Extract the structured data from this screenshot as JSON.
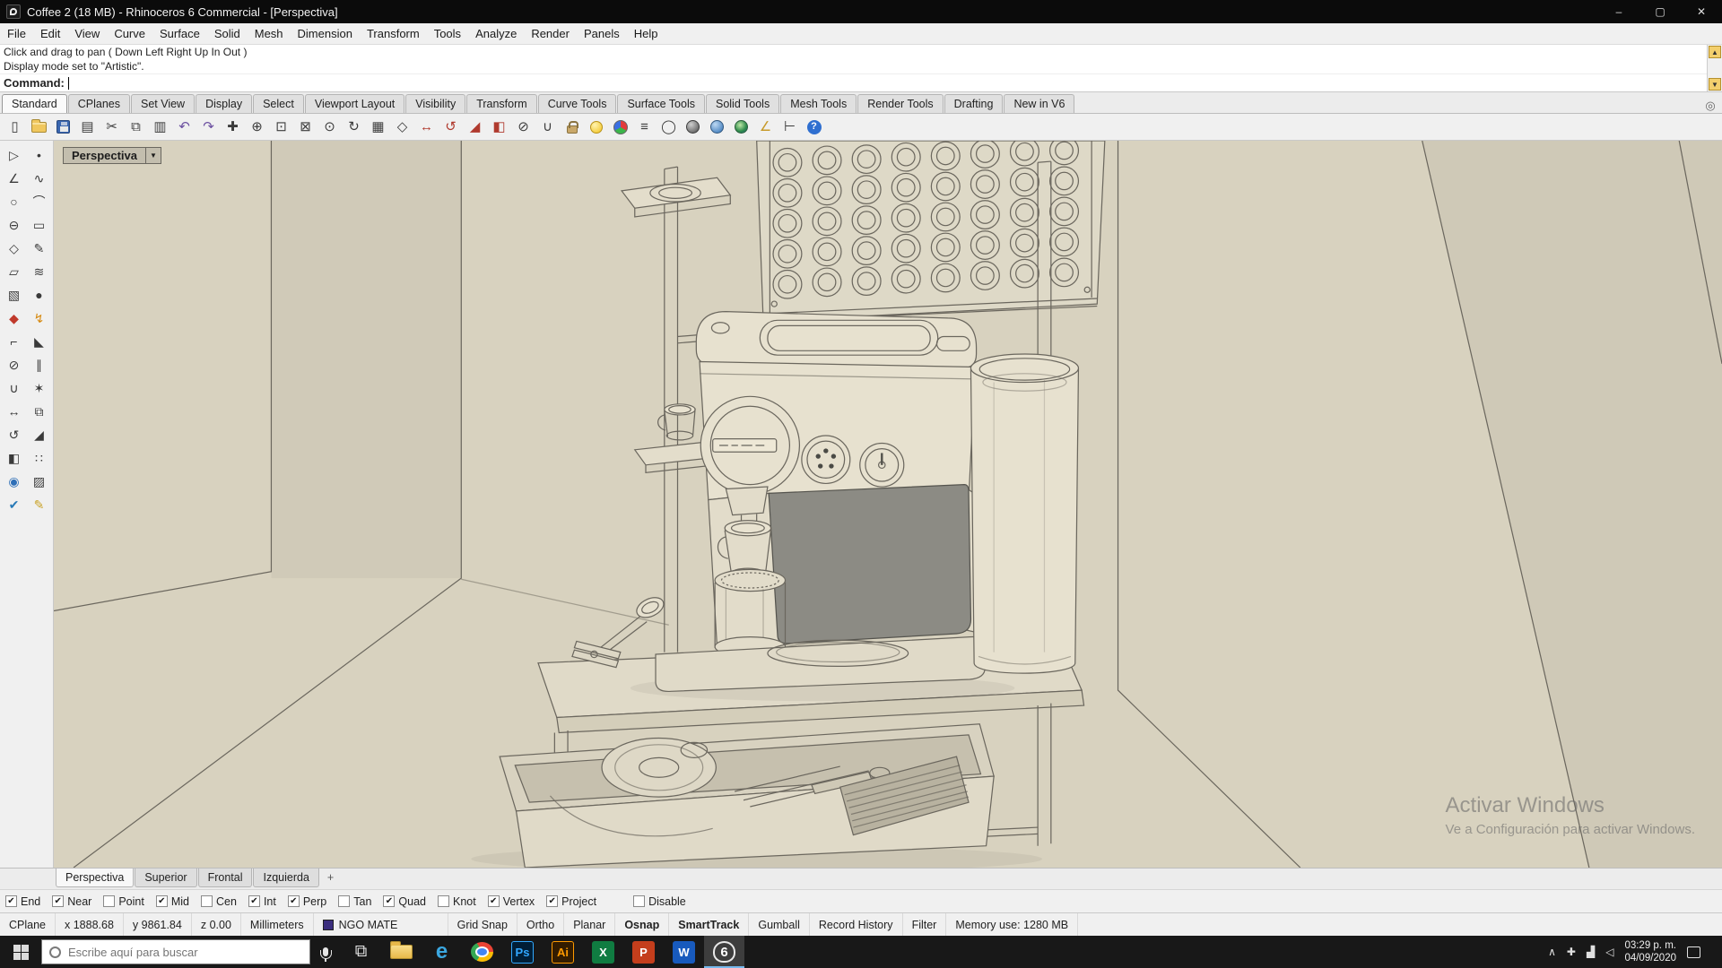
{
  "window": {
    "title": "Coffee 2 (18 MB) - Rhinoceros 6 Commercial - [Perspectiva]",
    "minimize": "–",
    "maximize": "▢",
    "close": "✕"
  },
  "menu": {
    "items": [
      "File",
      "Edit",
      "View",
      "Curve",
      "Surface",
      "Solid",
      "Mesh",
      "Dimension",
      "Transform",
      "Tools",
      "Analyze",
      "Render",
      "Panels",
      "Help"
    ]
  },
  "command": {
    "history": [
      "Click and drag to pan ( Down  Left  Right  Up  In  Out )",
      "Display mode set to \"Artistic\"."
    ],
    "prompt": "Command:",
    "scroll_up": "▲",
    "scroll_down": "▼"
  },
  "toolbar": {
    "options_glyph": "◎",
    "tabs": [
      {
        "label": "Standard",
        "cls": "active"
      },
      {
        "label": "CPlanes"
      },
      {
        "label": "Set View"
      },
      {
        "label": "Display"
      },
      {
        "label": "Select"
      },
      {
        "label": "Viewport Layout"
      },
      {
        "label": "Visibility"
      },
      {
        "label": "Transform"
      },
      {
        "label": "Curve Tools"
      },
      {
        "label": "Surface Tools"
      },
      {
        "label": "Solid Tools"
      },
      {
        "label": "Mesh Tools"
      },
      {
        "label": "Render Tools"
      },
      {
        "label": "Drafting"
      },
      {
        "label": "New in V6"
      }
    ],
    "icons": [
      {
        "name": "new-file-icon",
        "glyph": "▯"
      },
      {
        "name": "open-file-icon",
        "cls": "icon-folder"
      },
      {
        "name": "save-file-icon",
        "cls": "icon-save"
      },
      {
        "name": "print-icon",
        "glyph": "▤"
      },
      {
        "name": "cut-icon",
        "glyph": "✂"
      },
      {
        "name": "copy-icon",
        "glyph": "⧉"
      },
      {
        "name": "paste-icon",
        "glyph": "▥"
      },
      {
        "name": "undo-icon",
        "glyph": "↶",
        "color": "#6b4fa0"
      },
      {
        "name": "redo-icon",
        "glyph": "↷",
        "color": "#6b4fa0"
      },
      {
        "name": "pan-icon",
        "glyph": "✚"
      },
      {
        "name": "zoom-dynamic-icon",
        "glyph": "⊕"
      },
      {
        "name": "zoom-window-icon",
        "glyph": "⊡"
      },
      {
        "name": "zoom-extents-icon",
        "glyph": "⊠"
      },
      {
        "name": "zoom-selected-icon",
        "glyph": "⊙"
      },
      {
        "name": "rotate-view-icon",
        "glyph": "↻"
      },
      {
        "name": "viewport-layout-icon",
        "glyph": "▦"
      },
      {
        "name": "set-view-icon",
        "glyph": "◇"
      },
      {
        "name": "move-icon",
        "glyph": "↔",
        "color": "#b03a2e"
      },
      {
        "name": "rotate-icon",
        "glyph": "↺",
        "color": "#b03a2e"
      },
      {
        "name": "scale-icon",
        "glyph": "◢",
        "color": "#b03a2e"
      },
      {
        "name": "mirror-icon",
        "glyph": "◧",
        "color": "#b03a2e"
      },
      {
        "name": "trim-icon",
        "glyph": "⊘"
      },
      {
        "name": "join-icon",
        "glyph": "∪"
      },
      {
        "name": "lock-icon",
        "cls": "icon-lock"
      },
      {
        "name": "hide-lightbulb-icon",
        "cls": "icon-bulb"
      },
      {
        "name": "layers-icon",
        "cls": "icon-wheel"
      },
      {
        "name": "properties-icon",
        "glyph": "≡"
      },
      {
        "name": "wireframe-display-icon",
        "glyph": "◯"
      },
      {
        "name": "shaded-display-icon",
        "cls": "icon-sphere-dark"
      },
      {
        "name": "rendered-display-icon",
        "cls": "icon-sphere-blue"
      },
      {
        "name": "raytrace-display-icon",
        "cls": "icon-globe"
      },
      {
        "name": "measure-angle-icon",
        "glyph": "∠",
        "color": "#c79a2a"
      },
      {
        "name": "dimension-icon",
        "glyph": "⊢"
      },
      {
        "name": "help-icon",
        "cls": "icon-help"
      }
    ]
  },
  "palette": {
    "icons": [
      {
        "name": "select-icon",
        "glyph": "▷"
      },
      {
        "name": "point-icon",
        "glyph": "•"
      },
      {
        "name": "polyline-icon",
        "glyph": "∠"
      },
      {
        "name": "curve-icon",
        "glyph": "∿"
      },
      {
        "name": "circle-icon",
        "glyph": "○"
      },
      {
        "name": "arc-icon",
        "glyph": "⌒"
      },
      {
        "name": "ellipse-icon",
        "glyph": "⊖"
      },
      {
        "name": "rectangle-icon",
        "glyph": "▭"
      },
      {
        "name": "polygon-icon",
        "glyph": "◇"
      },
      {
        "name": "sketch-icon",
        "glyph": "✎"
      },
      {
        "name": "surface-icon",
        "glyph": "▱"
      },
      {
        "name": "loft-icon",
        "glyph": "≋"
      },
      {
        "name": "box-icon",
        "glyph": "▧"
      },
      {
        "name": "sphere-icon",
        "glyph": "●"
      },
      {
        "name": "paintbrush-icon",
        "glyph": "◆",
        "color": "#c0392b"
      },
      {
        "name": "lightning-icon",
        "glyph": "↯",
        "color": "#d68910"
      },
      {
        "name": "fillet-icon",
        "glyph": "⌐"
      },
      {
        "name": "chamfer-icon",
        "glyph": "◣"
      },
      {
        "name": "trim-icon",
        "glyph": "⊘"
      },
      {
        "name": "split-icon",
        "glyph": "∥"
      },
      {
        "name": "join-icon",
        "glyph": "∪"
      },
      {
        "name": "explode-icon",
        "glyph": "✶"
      },
      {
        "name": "move-icon",
        "glyph": "↔"
      },
      {
        "name": "copy-icon",
        "glyph": "⧉"
      },
      {
        "name": "rotate-icon",
        "glyph": "↺"
      },
      {
        "name": "scale-icon",
        "glyph": "◢"
      },
      {
        "name": "mirror-icon",
        "glyph": "◧"
      },
      {
        "name": "array-icon",
        "glyph": "∷"
      },
      {
        "name": "gumball-icon",
        "glyph": "◉",
        "color": "#2e6fb7"
      },
      {
        "name": "hatch-icon",
        "glyph": "▨"
      },
      {
        "name": "check-icon",
        "glyph": "✔",
        "color": "#2779b7"
      },
      {
        "name": "pencil-icon",
        "glyph": "✎",
        "color": "#c9a227"
      }
    ]
  },
  "viewport": {
    "label": "Perspectiva",
    "dropdown": "▼",
    "watermark": {
      "line1": "Activar Windows",
      "line2": "Ve a Configuración para activar Windows."
    }
  },
  "viewport_tabs": {
    "add": "+",
    "tabs": [
      {
        "label": "Perspectiva",
        "cls": "active"
      },
      {
        "label": "Superior"
      },
      {
        "label": "Frontal"
      },
      {
        "label": "Izquierda"
      }
    ]
  },
  "osnap": {
    "items": [
      {
        "name": "osnap-end-checkbox",
        "label": "End",
        "state": "checked"
      },
      {
        "name": "osnap-near-checkbox",
        "label": "Near",
        "state": "checked"
      },
      {
        "name": "osnap-point-checkbox",
        "label": "Point",
        "state": "unchecked"
      },
      {
        "name": "osnap-mid-checkbox",
        "label": "Mid",
        "state": "checked"
      },
      {
        "name": "osnap-cen-checkbox",
        "label": "Cen",
        "state": "unchecked"
      },
      {
        "name": "osnap-int-checkbox",
        "label": "Int",
        "state": "checked"
      },
      {
        "name": "osnap-perp-checkbox",
        "label": "Perp",
        "state": "checked"
      },
      {
        "name": "osnap-tan-checkbox",
        "label": "Tan",
        "state": "unchecked"
      },
      {
        "name": "osnap-quad-checkbox",
        "label": "Quad",
        "state": "checked"
      },
      {
        "name": "osnap-knot-checkbox",
        "label": "Knot",
        "state": "unchecked"
      },
      {
        "name": "osnap-vertex-checkbox",
        "label": "Vertex",
        "state": "checked"
      },
      {
        "name": "osnap-project-checkbox",
        "label": "Project",
        "state": "checked"
      },
      {
        "name": "osnap-disable-checkbox",
        "label": "Disable",
        "state": "unchecked",
        "cls": "gap"
      }
    ]
  },
  "status": {
    "left": [
      {
        "name": "status-cplane",
        "label": "CPlane"
      },
      {
        "name": "status-x-coordinate",
        "label": "x 1888.68"
      },
      {
        "name": "status-y-coordinate",
        "label": "y 9861.84"
      },
      {
        "name": "status-z-coordinate",
        "label": "z 0.00"
      },
      {
        "name": "status-units",
        "label": "Millimeters"
      }
    ],
    "layer": {
      "label": "NGO MATE",
      "swatch": "#3b2e7e"
    },
    "toggles": [
      {
        "name": "status-grid-snap",
        "label": "Grid Snap"
      },
      {
        "name": "status-ortho",
        "label": "Ortho"
      },
      {
        "name": "status-planar",
        "label": "Planar"
      },
      {
        "name": "status-osnap",
        "label": "Osnap",
        "cls": "bold"
      },
      {
        "name": "status-smarttrack",
        "label": "SmartTrack",
        "cls": "bold"
      },
      {
        "name": "status-gumball",
        "label": "Gumball"
      },
      {
        "name": "status-record-history",
        "label": "Record History"
      },
      {
        "name": "status-filter",
        "label": "Filter"
      }
    ],
    "memory": "Memory use: 1280 MB"
  },
  "taskbar": {
    "search_placeholder": "Escribe aquí para buscar",
    "apps": [
      {
        "name": "task-view-icon",
        "glyph": "⧉",
        "cls": "tb-taskview"
      },
      {
        "name": "file-explorer-icon",
        "cls": "tb-folder"
      },
      {
        "name": "edge-icon",
        "glyph": "e",
        "cls": "tb-edge"
      },
      {
        "name": "chrome-icon",
        "cls": "tb-chrome"
      },
      {
        "name": "photoshop-icon",
        "glyph": "Ps",
        "cls": "tb-ps"
      },
      {
        "name": "illustrator-icon",
        "glyph": "Ai",
        "cls": "tb-ai"
      },
      {
        "name": "excel-icon",
        "glyph": "X",
        "cls": "tb-xl"
      },
      {
        "name": "powerpoint-icon",
        "glyph": "P",
        "cls": "tb-ppt"
      },
      {
        "name": "word-icon",
        "glyph": "W",
        "cls": "tb-word"
      },
      {
        "name": "rhino-taskbar-icon",
        "glyph": "6",
        "cls": "tb-rhino",
        "state": "active"
      }
    ],
    "tray": [
      {
        "name": "tray-chevron-icon",
        "glyph": "∧"
      },
      {
        "name": "tray-security-icon",
        "glyph": "✚"
      },
      {
        "name": "tray-network-icon",
        "glyph": "▟"
      },
      {
        "name": "tray-volume-icon",
        "glyph": "◁"
      }
    ],
    "clock": {
      "time": "03:29 p. m.",
      "date": "04/09/2020"
    }
  }
}
